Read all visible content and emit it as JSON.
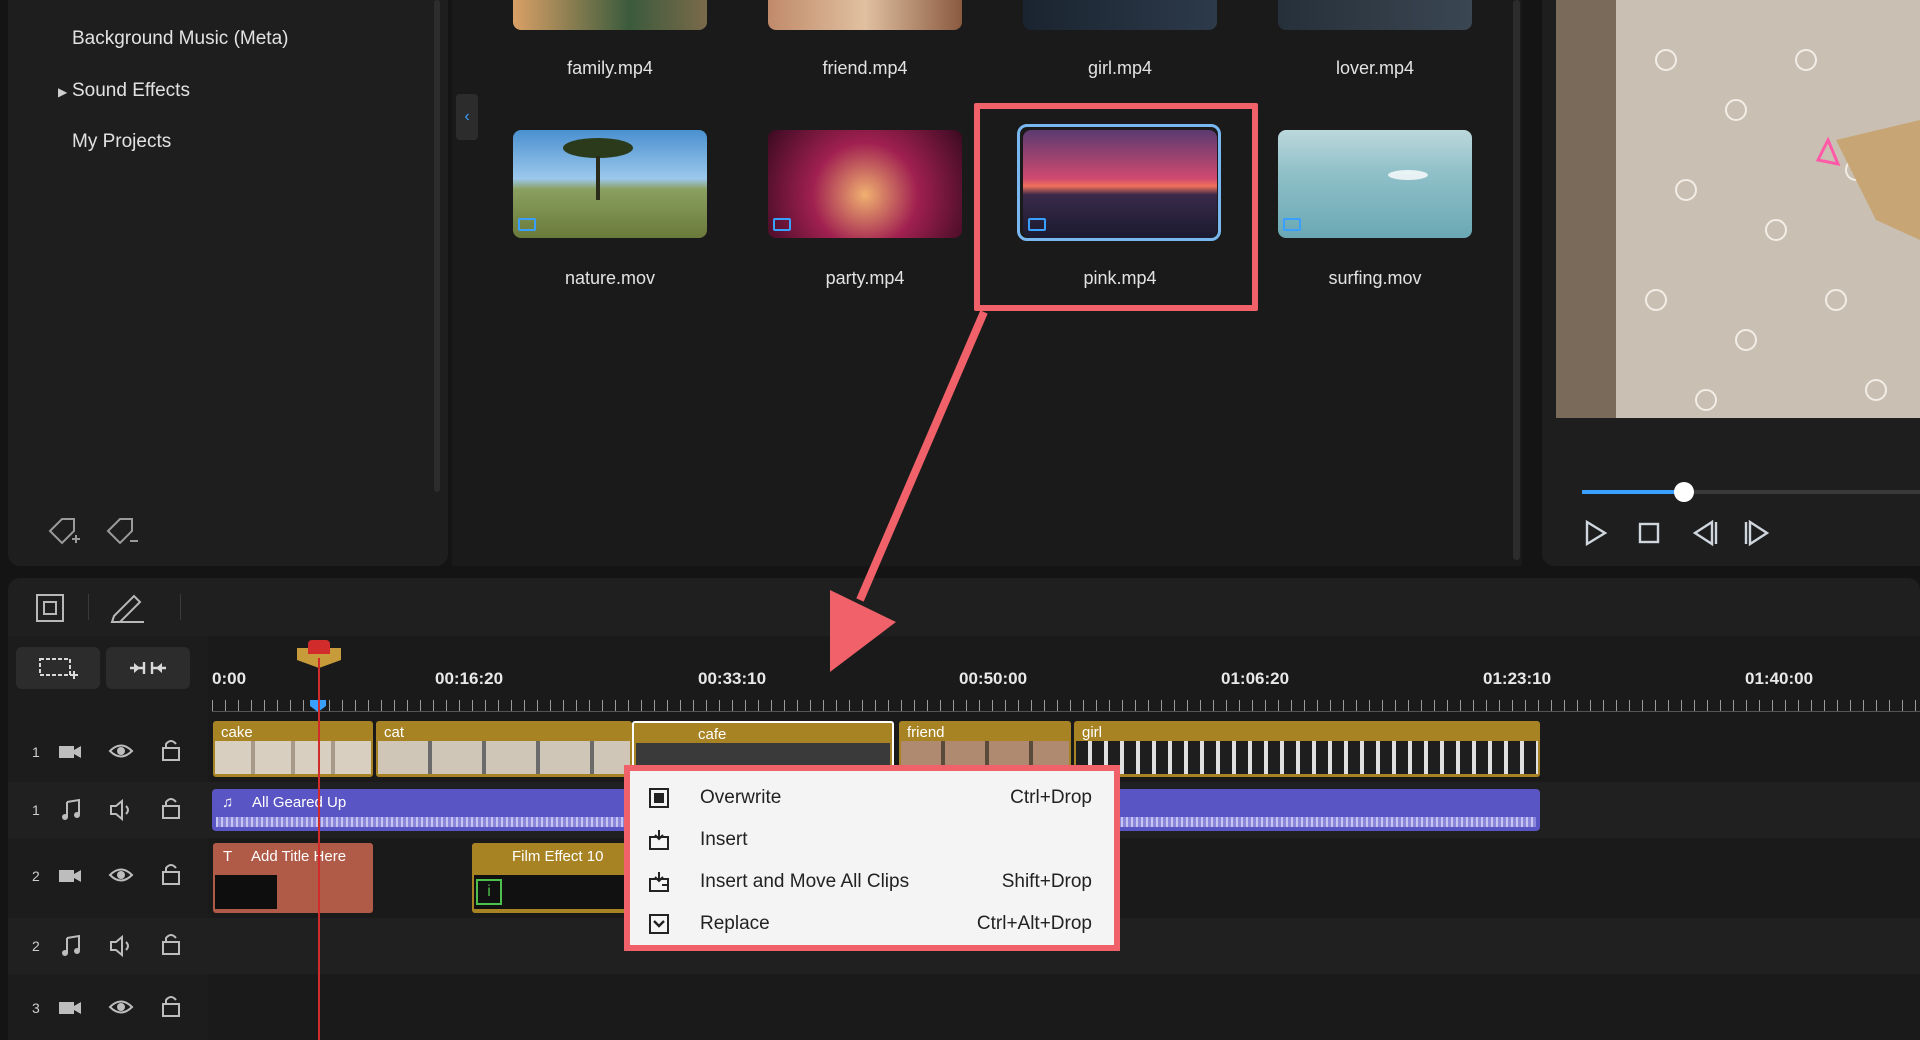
{
  "library": {
    "items": [
      {
        "label": "Background Music (Meta)",
        "expandable": false
      },
      {
        "label": "Sound Effects",
        "expandable": true
      },
      {
        "label": "My Projects",
        "expandable": false
      }
    ],
    "add_tag_icon": "tag-add-icon",
    "remove_tag_icon": "tag-remove-icon"
  },
  "media": {
    "top_row": [
      {
        "name": "family.mp4"
      },
      {
        "name": "friend.mp4"
      },
      {
        "name": "girl.mp4"
      },
      {
        "name": "lover.mp4"
      }
    ],
    "second_row": [
      {
        "name": "nature.mov"
      },
      {
        "name": "party.mp4"
      },
      {
        "name": "pink.mp4"
      },
      {
        "name": "surfing.mov"
      }
    ],
    "selected": "pink.mp4"
  },
  "preview": {
    "progress": 0.3,
    "controls": [
      "play-icon",
      "stop-icon",
      "prev-frame-icon",
      "next-frame-icon"
    ]
  },
  "timeline": {
    "ruler": [
      "0:00",
      "00:16:20",
      "00:33:10",
      "00:50:00",
      "01:06:20",
      "01:23:10",
      "01:40:00"
    ],
    "tracks": [
      {
        "num": "1",
        "kind": "video"
      },
      {
        "num": "1",
        "kind": "audio"
      },
      {
        "num": "2",
        "kind": "video"
      },
      {
        "num": "2",
        "kind": "audio"
      },
      {
        "num": "3",
        "kind": "video"
      }
    ],
    "video_clips_1": [
      "cake",
      "cat",
      "cafe",
      "friend",
      "girl"
    ],
    "audio_clip_1": "All Geared Up",
    "title_clip": "Add Title Here",
    "effect_clip": "Film Effect 10"
  },
  "context_menu": {
    "items": [
      {
        "label": "Overwrite",
        "shortcut": "Ctrl+Drop"
      },
      {
        "label": "Insert",
        "shortcut": ""
      },
      {
        "label": "Insert and Move All Clips",
        "shortcut": "Shift+Drop"
      },
      {
        "label": "Replace",
        "shortcut": "Ctrl+Alt+Drop"
      }
    ]
  },
  "colors": {
    "accent": "#3aa0ff",
    "highlight": "#f06169",
    "clip": "#a78323",
    "audio": "#5a55c4"
  }
}
